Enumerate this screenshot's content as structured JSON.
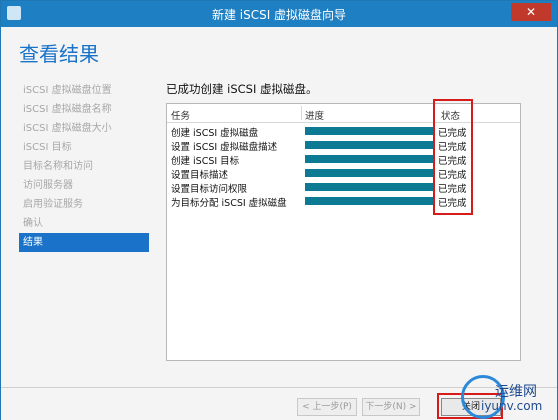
{
  "window": {
    "title": "新建 iSCSI 虚拟磁盘向导",
    "close_label": "✕"
  },
  "header": {
    "title": "查看结果"
  },
  "sidebar": {
    "items": [
      {
        "label": "iSCSI 虚拟磁盘位置"
      },
      {
        "label": "iSCSI 虚拟磁盘名称"
      },
      {
        "label": "iSCSI 虚拟磁盘大小"
      },
      {
        "label": "iSCSI 目标"
      },
      {
        "label": "目标名称和访问"
      },
      {
        "label": "访问服务器"
      },
      {
        "label": "启用验证服务"
      },
      {
        "label": "确认"
      },
      {
        "label": "结果"
      }
    ]
  },
  "content": {
    "success_message": "已成功创建 iSCSI 虚拟磁盘。",
    "table": {
      "columns": [
        "任务",
        "进度",
        "状态"
      ],
      "rows": [
        {
          "task": "创建 iSCSI 虚拟磁盘",
          "progress": 1.0,
          "status": "已完成"
        },
        {
          "task": "设置 iSCSI 虚拟磁盘描述",
          "progress": 1.0,
          "status": "已完成"
        },
        {
          "task": "创建 iSCSI 目标",
          "progress": 1.0,
          "status": "已完成"
        },
        {
          "task": "设置目标描述",
          "progress": 1.0,
          "status": "已完成"
        },
        {
          "task": "设置目标访问权限",
          "progress": 1.0,
          "status": "已完成"
        },
        {
          "task": "为目标分配 iSCSI 虚拟磁盘",
          "progress": 1.0,
          "status": "已完成"
        }
      ]
    }
  },
  "footer": {
    "prev_label": "< 上一步(P)",
    "next_label": "下一步(N) >",
    "close_label": "关闭"
  },
  "watermark": {
    "text": "运维网",
    "url": "iyunv.com"
  },
  "colors": {
    "accent": "#1a73c9",
    "progress": "#0d7a93",
    "highlight": "#d71b1b"
  }
}
